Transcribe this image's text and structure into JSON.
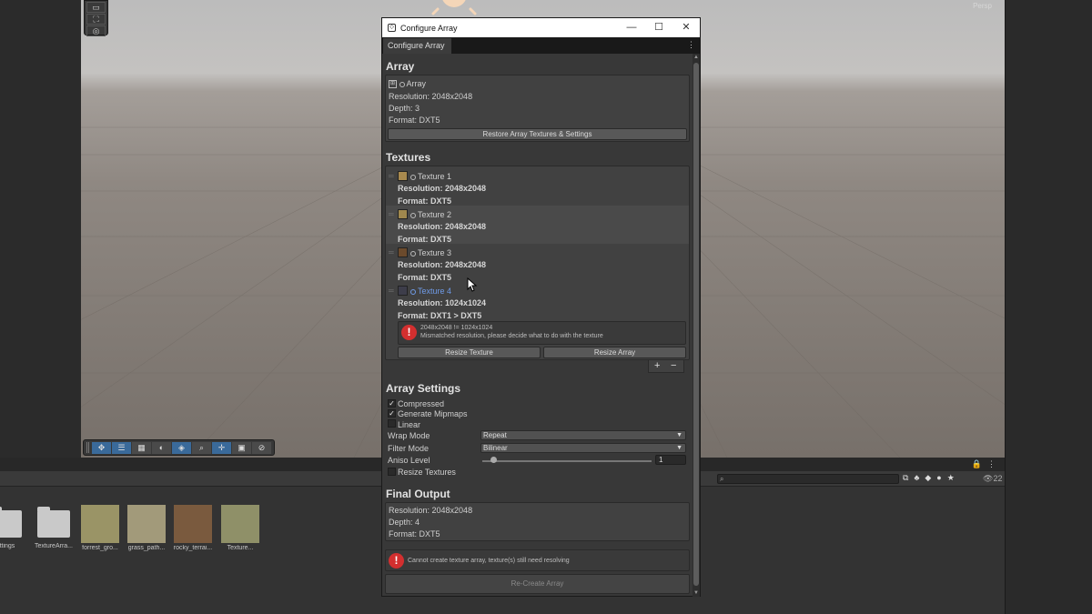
{
  "scene": {
    "perspective_label": "Persp",
    "toolbar_icons": [
      "move-icon",
      "layers-icon",
      "grid-icon",
      "orbit-icon",
      "snap-icon",
      "zoom-icon",
      "pan-icon",
      "camera-icon",
      "compass-icon"
    ]
  },
  "window": {
    "title": "Configure Array",
    "tab_label": "Configure Array",
    "minimize": "—",
    "maximize": "☐",
    "close": "✕"
  },
  "array": {
    "heading": "Array",
    "name": "Array",
    "resolution": "Resolution: 2048x2048",
    "depth": "Depth: 3",
    "format": "Format: DXT5",
    "restore_button": "Restore Array Textures & Settings"
  },
  "textures": {
    "heading": "Textures",
    "items": [
      {
        "name": "Texture 1",
        "resolution": "Resolution: 2048x2048",
        "format": "Format: DXT5",
        "color": "#a8894e"
      },
      {
        "name": "Texture 2",
        "resolution": "Resolution: 2048x2048",
        "format": "Format: DXT5",
        "color": "#a0884e"
      },
      {
        "name": "Texture 3",
        "resolution": "Resolution: 2048x2048",
        "format": "Format: DXT5",
        "color": "#6b4a2c"
      },
      {
        "name": "Texture 4",
        "resolution": "Resolution: 1024x1024",
        "format": "Format: DXT1 > DXT5",
        "color": "#3d3d4a"
      }
    ],
    "warning_line1": "2048x2048 != 1024x1024",
    "warning_line2": "Mismatched resolution, please decide what to do with the texture",
    "resize_texture_button": "Resize Texture",
    "resize_array_button": "Resize Array",
    "add_button": "+",
    "remove_button": "−"
  },
  "array_settings": {
    "heading": "Array Settings",
    "compressed": "Compressed",
    "generate_mipmaps": "Generate Mipmaps",
    "linear": "Linear",
    "wrap_mode_label": "Wrap Mode",
    "wrap_mode_value": "Repeat",
    "filter_mode_label": "Filter Mode",
    "filter_mode_value": "Bilinear",
    "aniso_label": "Aniso Level",
    "aniso_value": "1",
    "resize_textures": "Resize Textures"
  },
  "final_output": {
    "heading": "Final Output",
    "resolution": "Resolution: 2048x2048",
    "depth": "Depth: 4",
    "format": "Format: DXT5",
    "error": "Cannot create texture array, texture(s) still need resolving",
    "recreate_button": "Re-Create Array"
  },
  "project": {
    "count": "22",
    "assets": [
      {
        "name": "ettings",
        "kind": "folder"
      },
      {
        "name": "TextureArra...",
        "kind": "folder"
      },
      {
        "name": "forrest_gro...",
        "kind": "texture",
        "color": "#9a9466"
      },
      {
        "name": "grass_path...",
        "kind": "texture",
        "color": "#a29a7a"
      },
      {
        "name": "rocky_terrai...",
        "kind": "texture",
        "color": "#7a5a3e"
      },
      {
        "name": "Texture...",
        "kind": "texture",
        "color": "#8f9068"
      }
    ]
  }
}
